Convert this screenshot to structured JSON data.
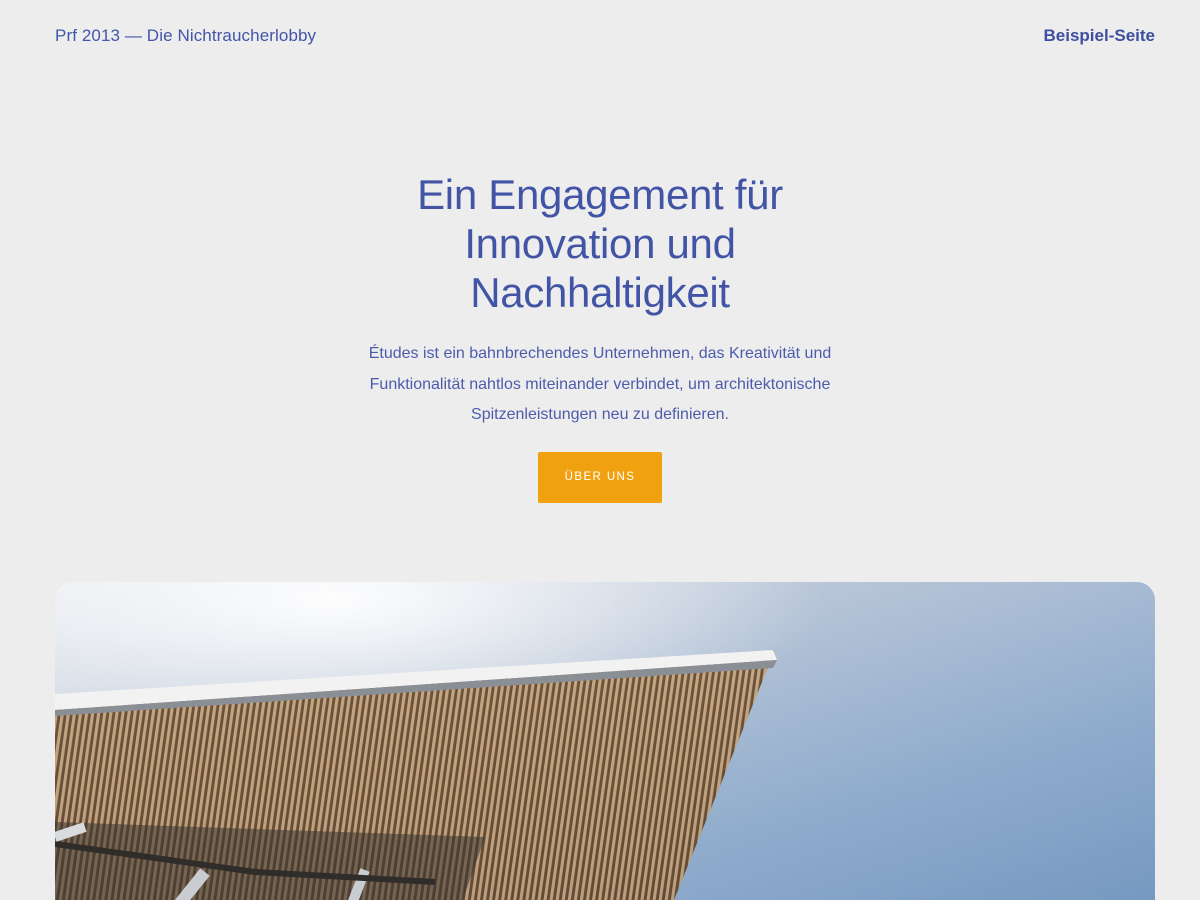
{
  "header": {
    "site_title": "Prf 2013 — Die Nichtraucherlobby",
    "nav_link": "Beispiel-Seite"
  },
  "hero": {
    "heading": "Ein Engagement für Innovation und Nachhaltigkeit",
    "text": "Études ist ein bahnbrechendes Unternehmen, das Kreativität und Funktionalität nahtlos miteinander verbindet, um architektonische Spitzenleistungen neu zu definieren.",
    "button_label": "ÜBER UNS"
  },
  "colors": {
    "background": "#ededed",
    "text_primary": "#4254a6",
    "button": "#f0a10f",
    "sky": "#7ea0c6"
  }
}
